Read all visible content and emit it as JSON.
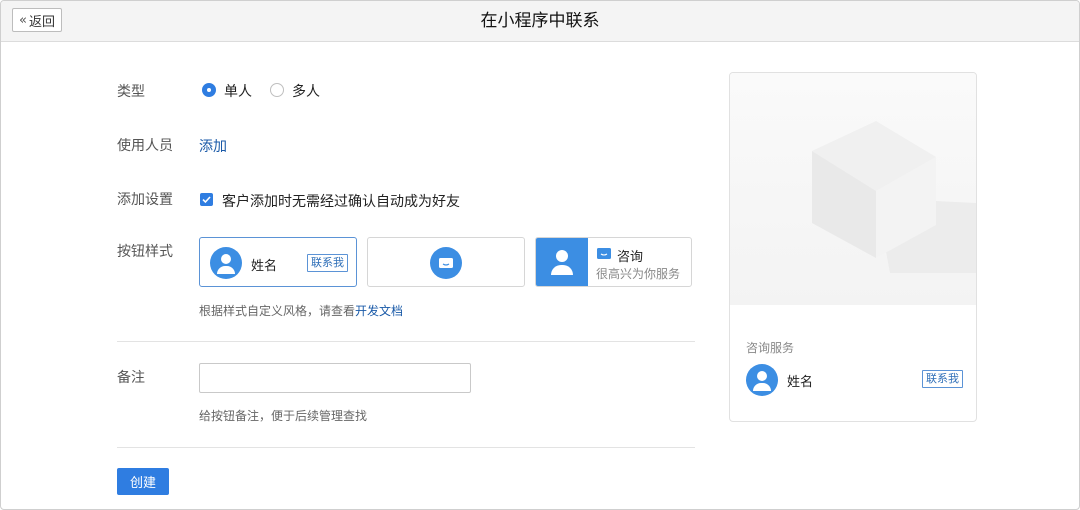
{
  "window": {
    "title": "在小程序中联系",
    "back_label": "返回"
  },
  "form": {
    "type_label": "类型",
    "type_options": [
      "单人",
      "多人"
    ],
    "type_selected": "单人",
    "users_label": "使用人员",
    "users_add_link": "添加",
    "add_settings_label": "添加设置",
    "add_settings_checkbox": "客户添加时无需经过确认自动成为好友",
    "add_settings_checked": true,
    "button_style_label": "按钮样式",
    "style_options": {
      "card1": {
        "name": "姓名",
        "tag": "联系我"
      },
      "card3": {
        "title": "咨询",
        "subtitle": "很高兴为你服务"
      }
    },
    "style_hint_prefix": "根据样式自定义风格，请查看",
    "style_hint_link": "开发文档",
    "note_label": "备注",
    "note_value": "",
    "note_hint": "给按钮备注，便于后续管理查找",
    "create_button": "创建"
  },
  "preview": {
    "section_title": "咨询服务",
    "name": "姓名",
    "tag": "联系我"
  },
  "colors": {
    "accent": "#2f7de1",
    "link": "#1a5aa8"
  }
}
